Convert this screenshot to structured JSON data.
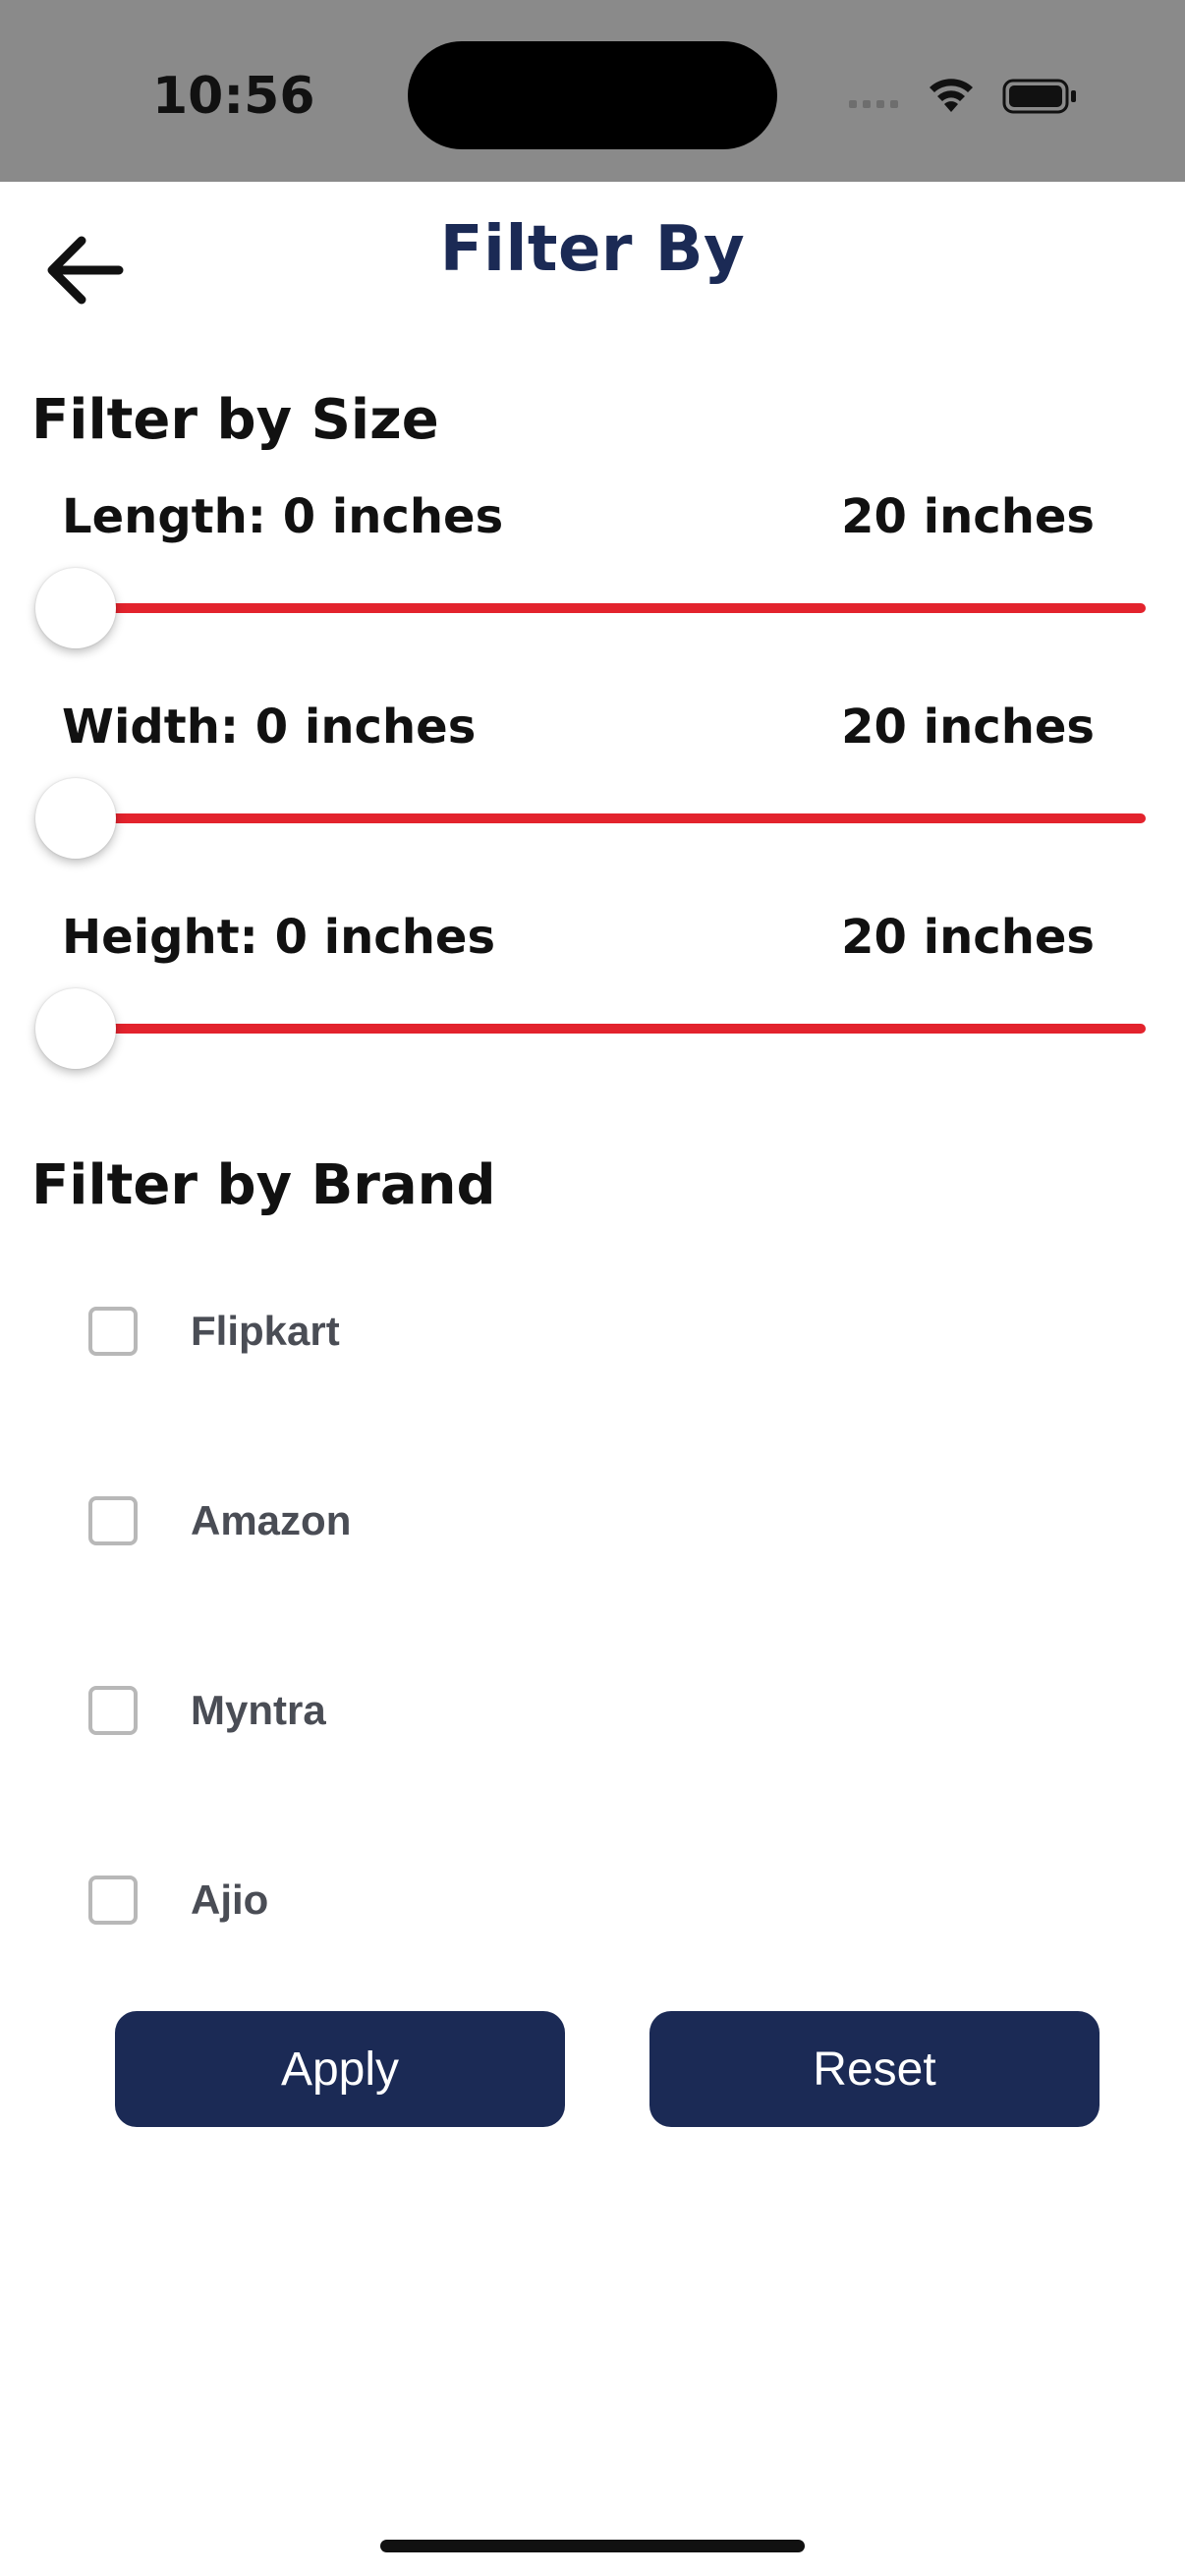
{
  "status_bar": {
    "time": "10:56"
  },
  "header": {
    "title": "Filter By"
  },
  "size_filter": {
    "title": "Filter by Size",
    "sliders": [
      {
        "label": "Length: 0 inches",
        "max_label": "20 inches",
        "value": 0,
        "min": 0,
        "max": 20
      },
      {
        "label": "Width: 0 inches",
        "max_label": "20 inches",
        "value": 0,
        "min": 0,
        "max": 20
      },
      {
        "label": "Height: 0 inches",
        "max_label": "20 inches",
        "value": 0,
        "min": 0,
        "max": 20
      }
    ]
  },
  "brand_filter": {
    "title": "Filter by Brand",
    "brands": [
      {
        "label": "Flipkart",
        "checked": false
      },
      {
        "label": "Amazon",
        "checked": false
      },
      {
        "label": "Myntra",
        "checked": false
      },
      {
        "label": "Ajio",
        "checked": false
      }
    ]
  },
  "actions": {
    "apply_label": "Apply",
    "reset_label": "Reset"
  },
  "colors": {
    "accent_navy": "#1b2a55",
    "slider_red": "#e3232d"
  }
}
